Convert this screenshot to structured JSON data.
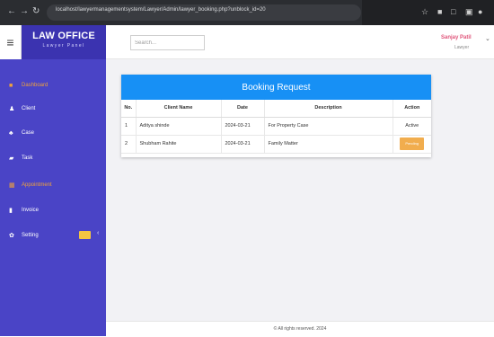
{
  "browser": {
    "url": "localhost/lawyermanagementsystem/Lawyer/Admin/lawyer_booking.php?unblock_id=20",
    "nav_back": "←",
    "nav_forward": "→",
    "nav_reload": "↻"
  },
  "brand": {
    "title": "LAW OFFICE",
    "subtitle": "Lawyer Panel"
  },
  "search": {
    "placeholder": "Search..."
  },
  "user": {
    "name": "Sanjay Patil",
    "role": "Lawyer"
  },
  "sidebar": {
    "items": [
      {
        "label": "Dashboard",
        "icon": "home-icon",
        "active": true
      },
      {
        "label": "Client",
        "icon": "user-icon",
        "active": false
      },
      {
        "label": "Case",
        "icon": "users-icon",
        "active": false
      },
      {
        "label": "Task",
        "icon": "file-icon",
        "active": false
      },
      {
        "label": "Appointment",
        "icon": "calendar-icon",
        "active": true
      },
      {
        "label": "Invoice",
        "icon": "invoice-icon",
        "active": false
      },
      {
        "label": "Setting",
        "icon": "gear-icon",
        "active": false
      }
    ]
  },
  "booking": {
    "title": "Booking Request",
    "columns": [
      "No.",
      "Client Name",
      "Date",
      "Description",
      "Action"
    ],
    "rows": [
      {
        "no": "1",
        "client": "Aditya shinde",
        "date": "2024-03-21",
        "description": "For Property Case",
        "action": "Active"
      },
      {
        "no": "2",
        "client": "Shubham Rahite",
        "date": "2024-03-21",
        "description": "Family Matter",
        "action": "Pending"
      }
    ]
  },
  "footer": {
    "text": "© All rights reserved. 2024"
  },
  "colors": {
    "sidebar": "#4a44c6",
    "brand": "#3b33b0",
    "header_blue": "#1790f5",
    "active_orange": "#f0a23b",
    "pending": "#f1ad4e",
    "user_pink": "#e0567b"
  }
}
